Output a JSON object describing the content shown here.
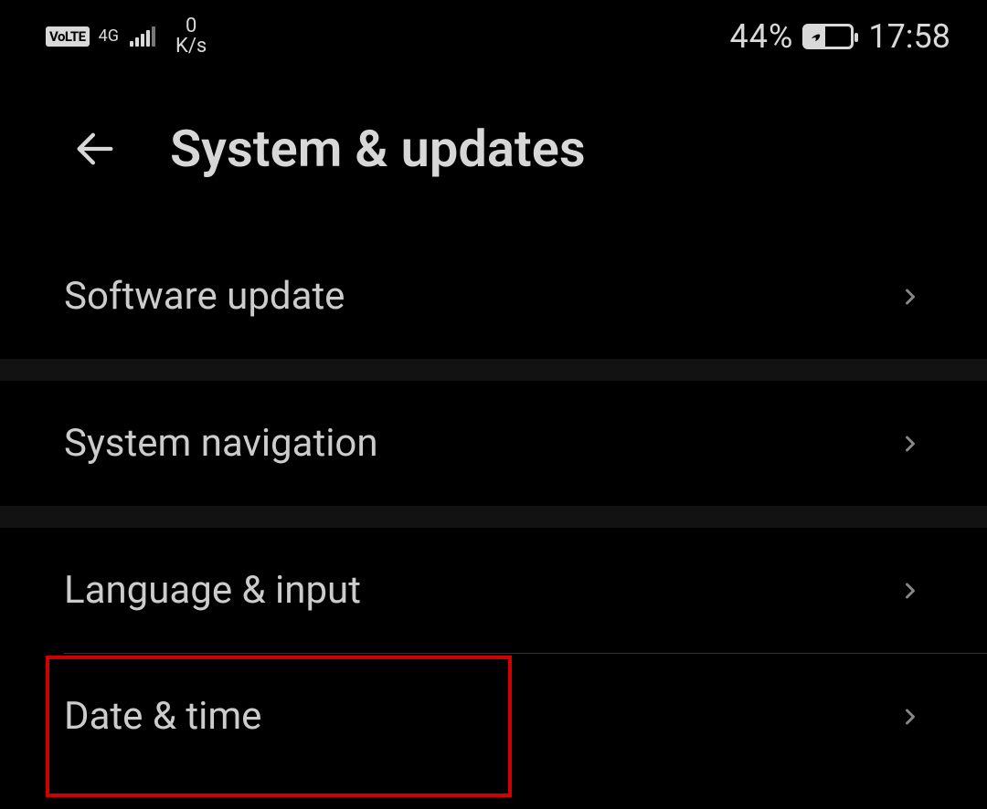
{
  "statusbar": {
    "volte": "VoLTE",
    "network_type": "4G",
    "speed_value": "0",
    "speed_unit": "K/s",
    "battery_percent": "44%",
    "time": "17:58"
  },
  "header": {
    "title": "System & updates"
  },
  "items": [
    {
      "label": "Software update"
    },
    {
      "label": "System navigation"
    },
    {
      "label": "Language & input"
    },
    {
      "label": "Date & time"
    }
  ]
}
